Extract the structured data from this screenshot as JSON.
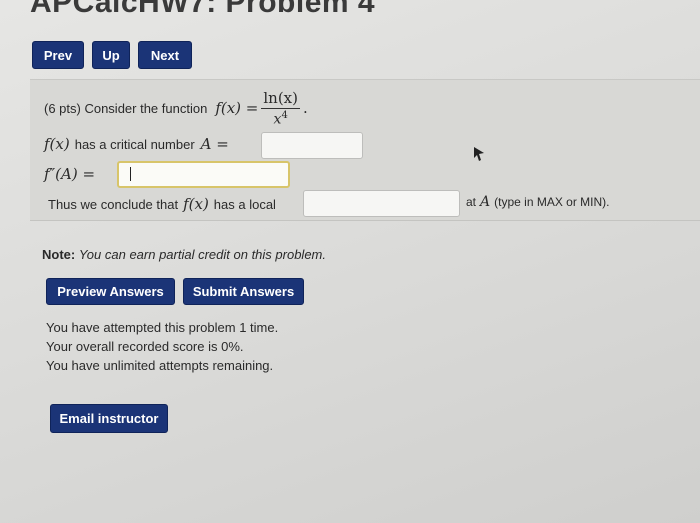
{
  "header": {
    "title": "APCalcHW7: Problem 4"
  },
  "nav": {
    "prev_label": "Prev",
    "up_label": "Up",
    "next_label": "Next"
  },
  "problem": {
    "points_prefix": "(6 pts) Consider the function",
    "function_def": "f(x) =",
    "numerator": "ln(x)",
    "denominator_base": "x",
    "denominator_exp": "4",
    "end_period": ".",
    "critical_fx": "f(x)",
    "critical_text": "has a critical number",
    "critical_var": "A =",
    "second_deriv": "f″(A) =",
    "second_deriv_value": "",
    "conclude_prefix": "Thus we conclude that",
    "conclude_fx": "f(x)",
    "conclude_mid": "has a local",
    "conclude_at": "at",
    "conclude_var": "A",
    "conclude_suffix": "(type in MAX or MIN)."
  },
  "note": {
    "label": "Note:",
    "text": "You can earn partial credit on this problem."
  },
  "actions": {
    "preview_label": "Preview Answers",
    "submit_label": "Submit Answers"
  },
  "status": {
    "line1": "You have attempted this problem 1 time.",
    "line2": "Your overall recorded score is 0%.",
    "line3": "You have unlimited attempts remaining."
  },
  "email": {
    "label": "Email instructor"
  },
  "colors": {
    "button_bg": "#1b3477",
    "panel_bg": "#d8d8d5",
    "active_border": "#d8c56a"
  }
}
